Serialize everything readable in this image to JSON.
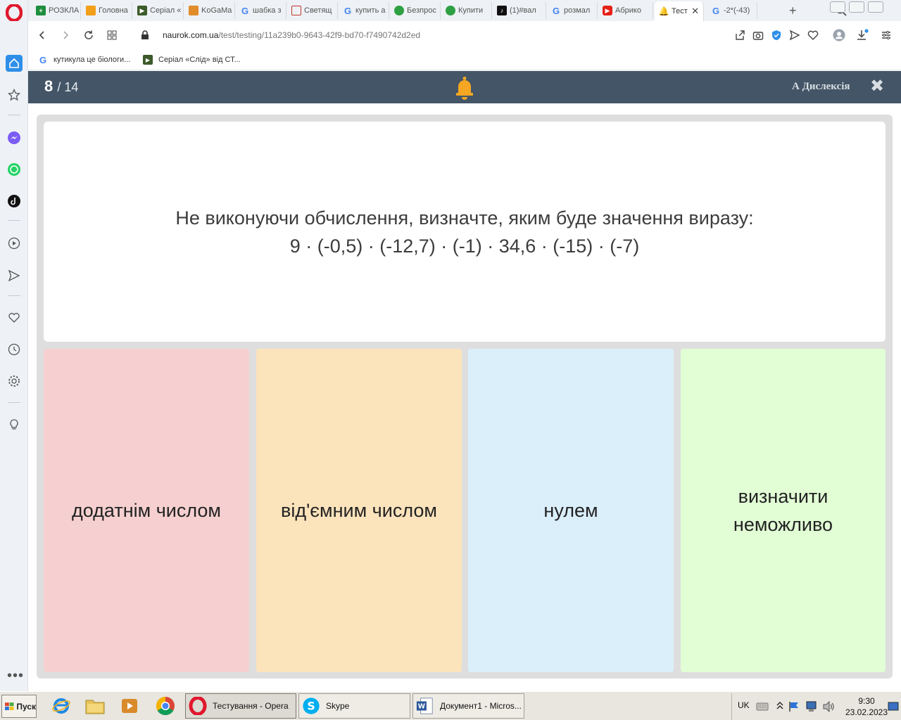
{
  "browser": {
    "tabs": [
      {
        "label": "РОЗКЛА",
        "icon": "green-square-icon",
        "color": "#1e8e3e"
      },
      {
        "label": "Головна",
        "icon": "orange-square-icon",
        "color": "#f29f1b"
      },
      {
        "label": "Серіал «",
        "icon": "film-icon",
        "color": "#3d5a2a"
      },
      {
        "label": "KoGaMa",
        "icon": "game-icon",
        "color": "#e08c2a"
      },
      {
        "label": "шабка з",
        "icon": "google-icon",
        "color": "#4285f4"
      },
      {
        "label": "Светящ",
        "icon": "shield-icon",
        "color": "#c0392b"
      },
      {
        "label": "купить а",
        "icon": "google-icon",
        "color": "#4285f4"
      },
      {
        "label": "Безпрос",
        "icon": "green-circle-icon",
        "color": "#2ea043"
      },
      {
        "label": "Купити",
        "icon": "green-circle-icon",
        "color": "#2ea043"
      },
      {
        "label": "(1)#вал",
        "icon": "tiktok-icon",
        "color": "#111111"
      },
      {
        "label": "розмал",
        "icon": "google-icon",
        "color": "#4285f4"
      },
      {
        "label": "Абрико",
        "icon": "youtube-icon",
        "color": "#e62117"
      },
      {
        "label": "Тест",
        "icon": "bell-icon",
        "color": "#f5a623",
        "active": true
      },
      {
        "label": "-2*(-43)",
        "icon": "google-icon",
        "color": "#4285f4"
      }
    ],
    "url_host": "naurok.com.ua",
    "url_path": "/test/testing/11a239b0-9643-42f9-bd70-f7490742d2ed",
    "bookmarks": [
      {
        "label": "кутикула це біологи...",
        "icon": "google-icon"
      },
      {
        "label": "Серіал «Слід» від СТ...",
        "icon": "film-icon"
      }
    ]
  },
  "quiz": {
    "current": "8",
    "total": "/ 14",
    "dyslexia_label": "А Дислексія",
    "close_symbol": "✖",
    "question_line1": "Не виконуючи обчислення, визначте, яким буде значення виразу:",
    "question_line2": "9 · (-0,5) · (-12,7) · (-1) · 34,6 · (-15) · (-7)",
    "answers": [
      {
        "label": "додатнім числом",
        "color": "#f6d0d0"
      },
      {
        "label": "від'ємним числом",
        "color": "#fbe3bc"
      },
      {
        "label": "нулем",
        "color": "#dbeffa"
      },
      {
        "label": "визначити неможливо",
        "color": "#e1fed5"
      }
    ],
    "header_color": "#435566",
    "bell_color": "#f5a623"
  },
  "taskbar": {
    "start_label": "Пуск",
    "windows": [
      {
        "label": "Тестування - Opera",
        "icon": "opera-icon",
        "active": true
      },
      {
        "label": "Skype",
        "icon": "skype-icon"
      },
      {
        "label": "Документ1 - Micros...",
        "icon": "word-icon"
      }
    ],
    "lang": "UK",
    "time": "9:30",
    "date": "23.02.2023"
  }
}
